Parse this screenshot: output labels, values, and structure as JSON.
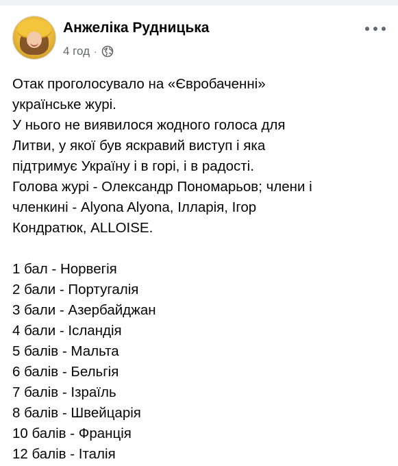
{
  "post": {
    "author": "Анжеліка Рудницька",
    "timestamp": "4 год",
    "separator": "·",
    "privacy_icon": "globe-icon",
    "more_icon": "more-options-icon",
    "paragraph": [
      "Отак проголосувало на «Євробаченні»",
      "українське журі.",
      "У нього не виявилося жодного голоса для",
      "Литви, у якої був яскравий виступ і яка",
      "підтримує Україну і в горі, і в радості.",
      "Голова журі - Олександр Пономарьов; члени і",
      "членкині - Alyona Alyona, Ілларія, Ігор",
      "Кондратюк, ALLOISE."
    ],
    "votes": [
      "1 бал - Норвегія",
      "2 бали - Португалія",
      "3 бали - Азербайджан",
      "4 бали - Ісландія",
      "5 балів - Мальта",
      "6 балів - Бельгія",
      "7 балів - Ізраїль",
      "8 балів - Швейцарія",
      "10 балів - Франція",
      "12 балів - Італія"
    ]
  },
  "colors": {
    "text": "#050505",
    "secondary_text": "#65676b",
    "background": "#ffffff"
  }
}
